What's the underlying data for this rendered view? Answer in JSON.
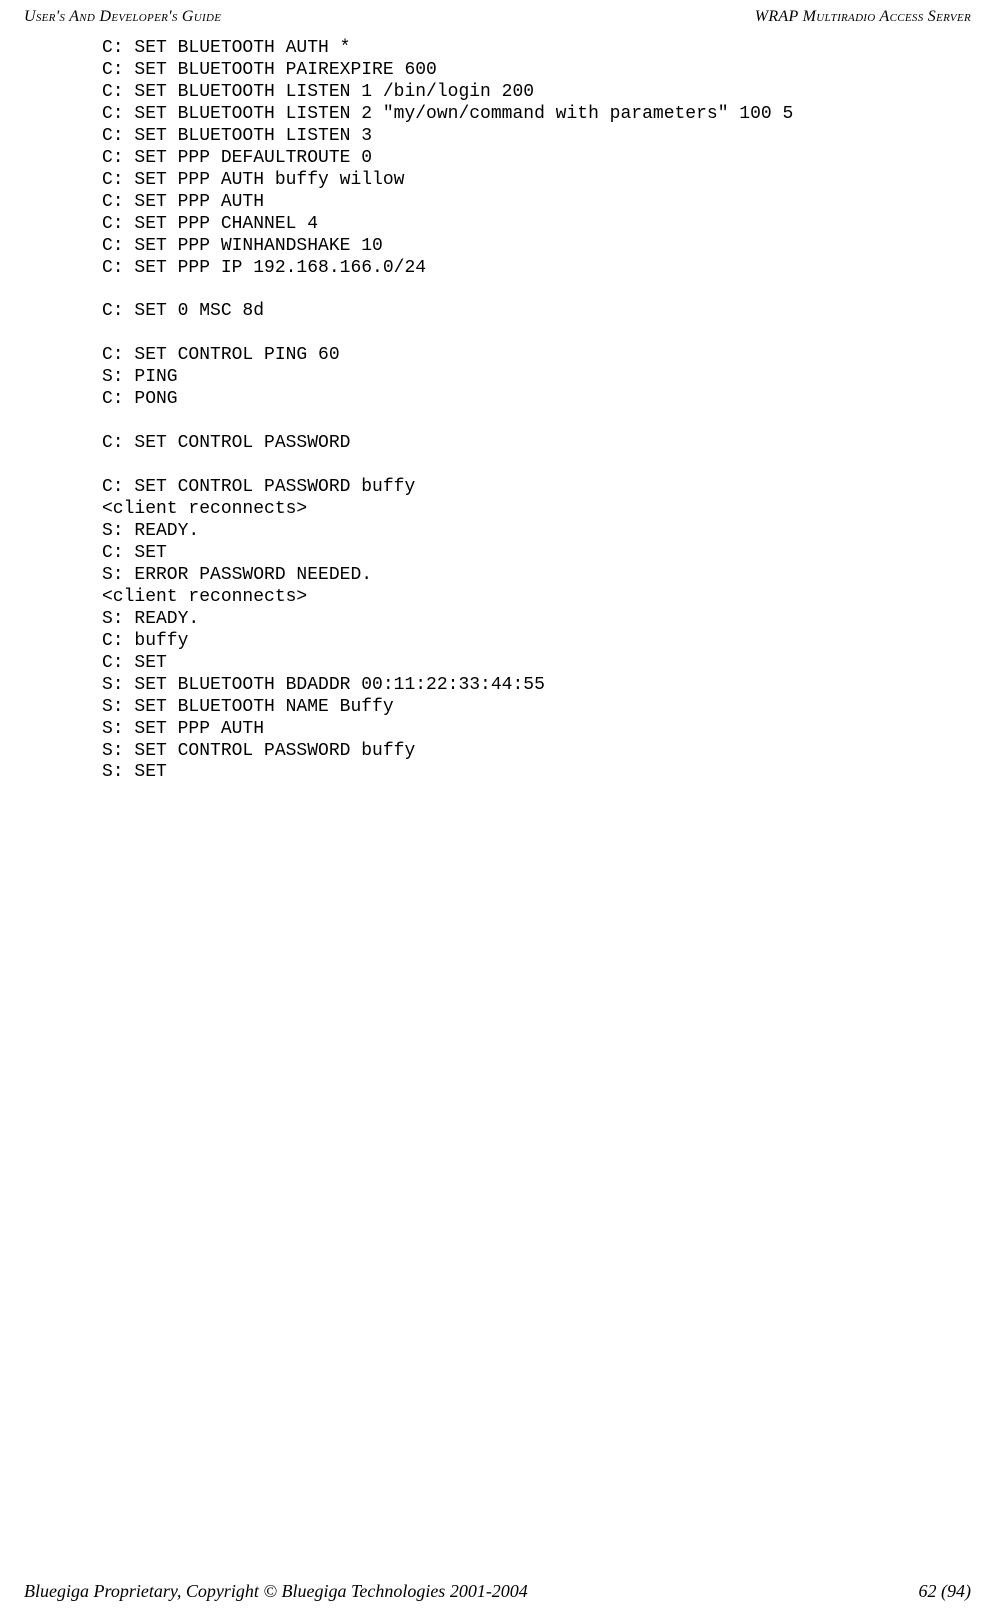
{
  "header": {
    "left": "User's And Developer's Guide",
    "right": "WRAP Multiradio Access Server"
  },
  "code": {
    "lines": [
      "C: SET BLUETOOTH AUTH *",
      "C: SET BLUETOOTH PAIREXPIRE 600",
      "C: SET BLUETOOTH LISTEN 1 /bin/login 200",
      "C: SET BLUETOOTH LISTEN 2 \"my/own/command with parameters\" 100 5",
      "C: SET BLUETOOTH LISTEN 3",
      "C: SET PPP DEFAULTROUTE 0",
      "C: SET PPP AUTH buffy willow",
      "C: SET PPP AUTH",
      "C: SET PPP CHANNEL 4",
      "C: SET PPP WINHANDSHAKE 10",
      "C: SET PPP IP 192.168.166.0/24",
      "",
      "C: SET 0 MSC 8d",
      "",
      "C: SET CONTROL PING 60",
      "S: PING",
      "C: PONG",
      "",
      "C: SET CONTROL PASSWORD",
      "",
      "C: SET CONTROL PASSWORD buffy",
      "<client reconnects>",
      "S: READY.",
      "C: SET",
      "S: ERROR PASSWORD NEEDED.",
      "<client reconnects>",
      "S: READY.",
      "C: buffy",
      "C: SET",
      "S: SET BLUETOOTH BDADDR 00:11:22:33:44:55",
      "S: SET BLUETOOTH NAME Buffy",
      "S: SET PPP AUTH",
      "S: SET CONTROL PASSWORD buffy",
      "S: SET"
    ]
  },
  "footer": {
    "left": "Bluegiga Proprietary, Copyright © Bluegiga Technologies 2001-2004",
    "right": "62 (94)"
  }
}
